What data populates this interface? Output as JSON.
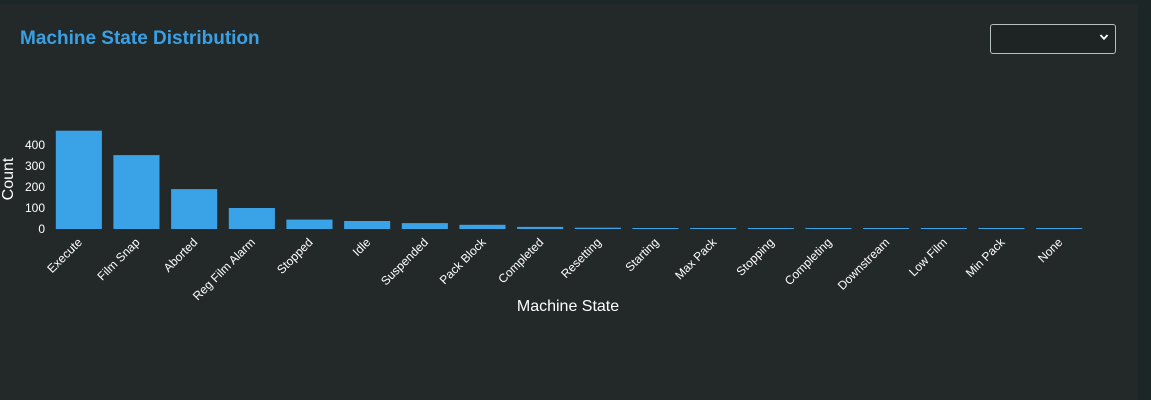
{
  "header": {
    "title": "Machine State Distribution",
    "select_value": ""
  },
  "colors": {
    "bar": "#3aa3e8",
    "title": "#39a0e5",
    "background": "#232828"
  },
  "chart_data": {
    "type": "bar",
    "title": "Machine State Distribution",
    "xlabel": "Machine State",
    "ylabel": "Count",
    "categories": [
      "Execute",
      "Film Snap",
      "Aborted",
      "Reg Film Alarm",
      "Stopped",
      "Idle",
      "Suspended",
      "Pack Block",
      "Completed",
      "Resetting",
      "Starting",
      "Max Pack",
      "Stopping",
      "Completing",
      "Downstream",
      "Low Film",
      "Min Pack",
      "None"
    ],
    "values": [
      468,
      352,
      190,
      100,
      45,
      38,
      28,
      20,
      10,
      6,
      3,
      2,
      2,
      2,
      2,
      2,
      2,
      1
    ],
    "yticks": [
      0,
      100,
      200,
      300,
      400
    ],
    "ylim": [
      0,
      480
    ],
    "grid": false,
    "legend": false
  }
}
